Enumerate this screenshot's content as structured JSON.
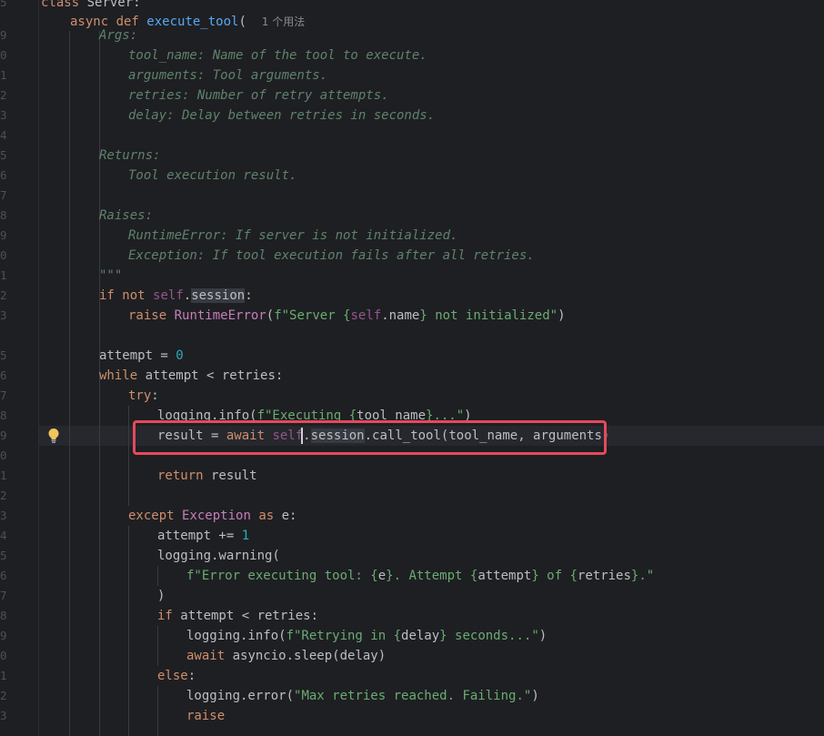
{
  "editor": {
    "usage_hint": "1 个用法",
    "line_numbers": [
      "5",
      "",
      "9",
      "0",
      "1",
      "2",
      "3",
      "4",
      "5",
      "6",
      "7",
      "8",
      "9",
      "0",
      "1",
      "2",
      "3",
      "",
      "5",
      "6",
      "7",
      "8",
      "9",
      "0",
      "1",
      "2",
      "3",
      "4",
      "5",
      "6",
      "7",
      "8",
      "9",
      "0",
      "1",
      "2",
      "3"
    ],
    "code": {
      "l0": {
        "kw": "class",
        "name": " Server:"
      },
      "l1": {
        "kw": "async def",
        "fn": "execute_tool",
        "rest": "("
      },
      "l2": "Args:",
      "l3": "tool_name: Name of the tool to execute.",
      "l4": "arguments: Tool arguments.",
      "l5": "retries: Number of retry attempts.",
      "l6": "delay: Delay between retries in seconds.",
      "l8": "Returns:",
      "l9": "Tool execution result.",
      "l11": "Raises:",
      "l12": "RuntimeError: If server is not initialized.",
      "l13": "Exception: If tool execution fails after all retries.",
      "l14": "\"\"\"",
      "l15": {
        "kw1": "if",
        "kw2": "not",
        "self": "self",
        "dot": ".",
        "attr": "session",
        "end": ":"
      },
      "l16": {
        "kw": "raise",
        "cls": "RuntimeError",
        "p1": "(",
        "s1": "f\"Server {",
        "self": "self",
        "name": ".name",
        "s2": "} not initialized\"",
        "p2": ")"
      },
      "l18": {
        "txt": "attempt = ",
        "num": "0"
      },
      "l19": {
        "kw": "while",
        "txt": " attempt < retries:"
      },
      "l20": {
        "kw": "try",
        "end": ":"
      },
      "l21": {
        "txt": "logging.info(",
        "s1": "f\"Executing {",
        "var": "tool_name",
        "s2": "}...\"",
        "end": ")"
      },
      "l22": {
        "txt": "result = ",
        "kw": "await",
        "self": "self",
        "dot": ".",
        "attr": "session",
        "rest": ".call_tool(tool_name, arguments)"
      },
      "l24": {
        "kw": "return",
        "txt": " result"
      },
      "l26": {
        "kw": "except",
        "cls": "Exception",
        "kw2": "as",
        "txt": " e:"
      },
      "l27": {
        "txt": "attempt += ",
        "num": "1"
      },
      "l28": "logging.warning(",
      "l29": {
        "s1": "f\"Error executing tool: {",
        "v1": "e",
        "s2": "}. Attempt {",
        "v2": "attempt",
        "s3": "} of {",
        "v3": "retries",
        "s4": "}.\""
      },
      "l30": ")",
      "l31": {
        "kw": "if",
        "txt": " attempt < retries:"
      },
      "l32": {
        "txt": "logging.info(",
        "s1": "f\"Retrying in {",
        "var": "delay",
        "s2": "} seconds...\"",
        "end": ")"
      },
      "l33": {
        "kw": "await",
        "txt": " asyncio.sleep(delay)"
      },
      "l34": {
        "kw": "else",
        "end": ":"
      },
      "l35": {
        "txt": "logging.error(",
        "str": "\"Max retries reached. Failing.\"",
        "end": ")"
      },
      "l36": "raise"
    }
  },
  "colors": {
    "background": "#1e1f22",
    "keyword": "#cf8e6d",
    "function": "#56a8f5",
    "string": "#6aab73",
    "number": "#2aacb8",
    "docstring": "#5f826b",
    "highlight_box": "#e5495c"
  },
  "icons": {
    "gutter": "lightbulb-icon"
  }
}
